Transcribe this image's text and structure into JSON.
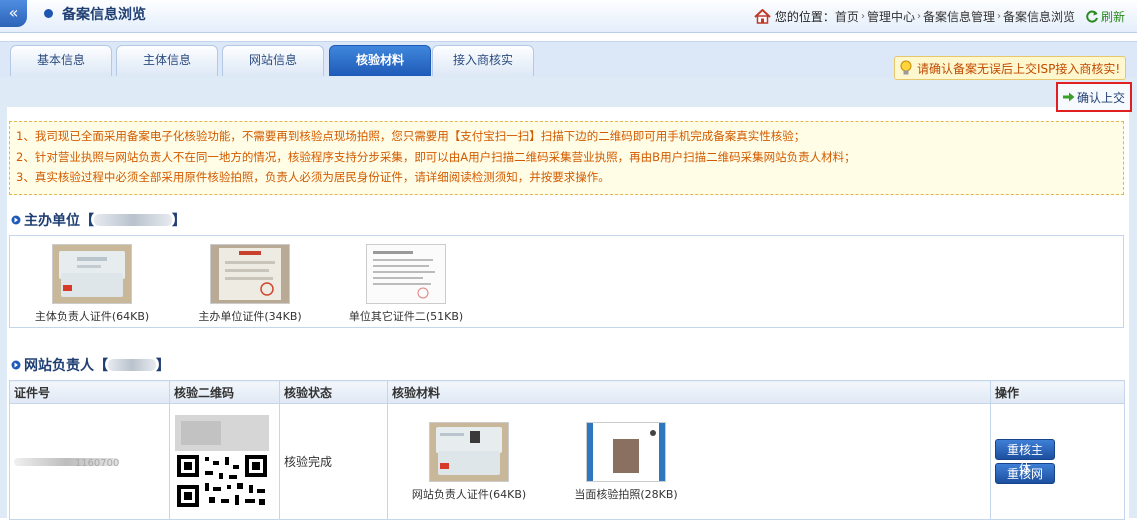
{
  "header": {
    "collapse_symbol": "«",
    "title": "备案信息浏览",
    "location_label": "您的位置：",
    "breadcrumbs": [
      "首页",
      "管理中心",
      "备案信息管理",
      "备案信息浏览"
    ],
    "breadcrumb_sep": "›",
    "refresh_label": "刷新"
  },
  "tabs": [
    {
      "label": "基本信息",
      "active": false
    },
    {
      "label": "主体信息",
      "active": false
    },
    {
      "label": "网站信息",
      "active": false
    },
    {
      "label": "核验材料",
      "active": true
    },
    {
      "label": "接入商核实",
      "active": false
    }
  ],
  "warning": {
    "text": "请确认备案无误后上交ISP接入商核实!"
  },
  "confirm_button": {
    "label": "确认上交"
  },
  "notice_lines": [
    "1、我司现已全面采用备案电子化核验功能，不需要再到核验点现场拍照，您只需要用【支付宝扫一扫】扫描下边的二维码即可用手机完成备案真实性核验；",
    "2、针对营业执照与网站负责人不在同一地方的情况，核验程序支持分步采集，即可以由A用户扫描二维码采集营业执照，再由B用户扫描二维码采集网站负责人材料；",
    "3、真实核验过程中必须全部采用原件核验拍照，负责人必须为居民身份证件，请详细阅读检测须知，并按要求操作。"
  ],
  "sponsor": {
    "title_prefix": "主办单位【",
    "title_suffix": "】",
    "items": [
      {
        "label": "主体负责人证件(64KB)"
      },
      {
        "label": "主办单位证件(34KB)"
      },
      {
        "label": "单位其它证件二(51KB)"
      }
    ]
  },
  "site_owner": {
    "title_prefix": "网站负责人【",
    "title_suffix": "】",
    "columns": [
      "证件号",
      "核验二维码",
      "核验状态",
      "核验材料",
      "操作"
    ],
    "row": {
      "cert_no_visible": "1160700",
      "status": "核验完成",
      "materials": [
        {
          "label": "网站负责人证件(64KB)"
        },
        {
          "label": "当面核验拍照(28KB)"
        }
      ],
      "actions": [
        "重核主体",
        "重核网站"
      ]
    }
  },
  "colors": {
    "accent": "#1f5ab8",
    "notice_text": "#d25a00",
    "warning_text": "#c04a00",
    "highlight_border": "#e02020"
  }
}
